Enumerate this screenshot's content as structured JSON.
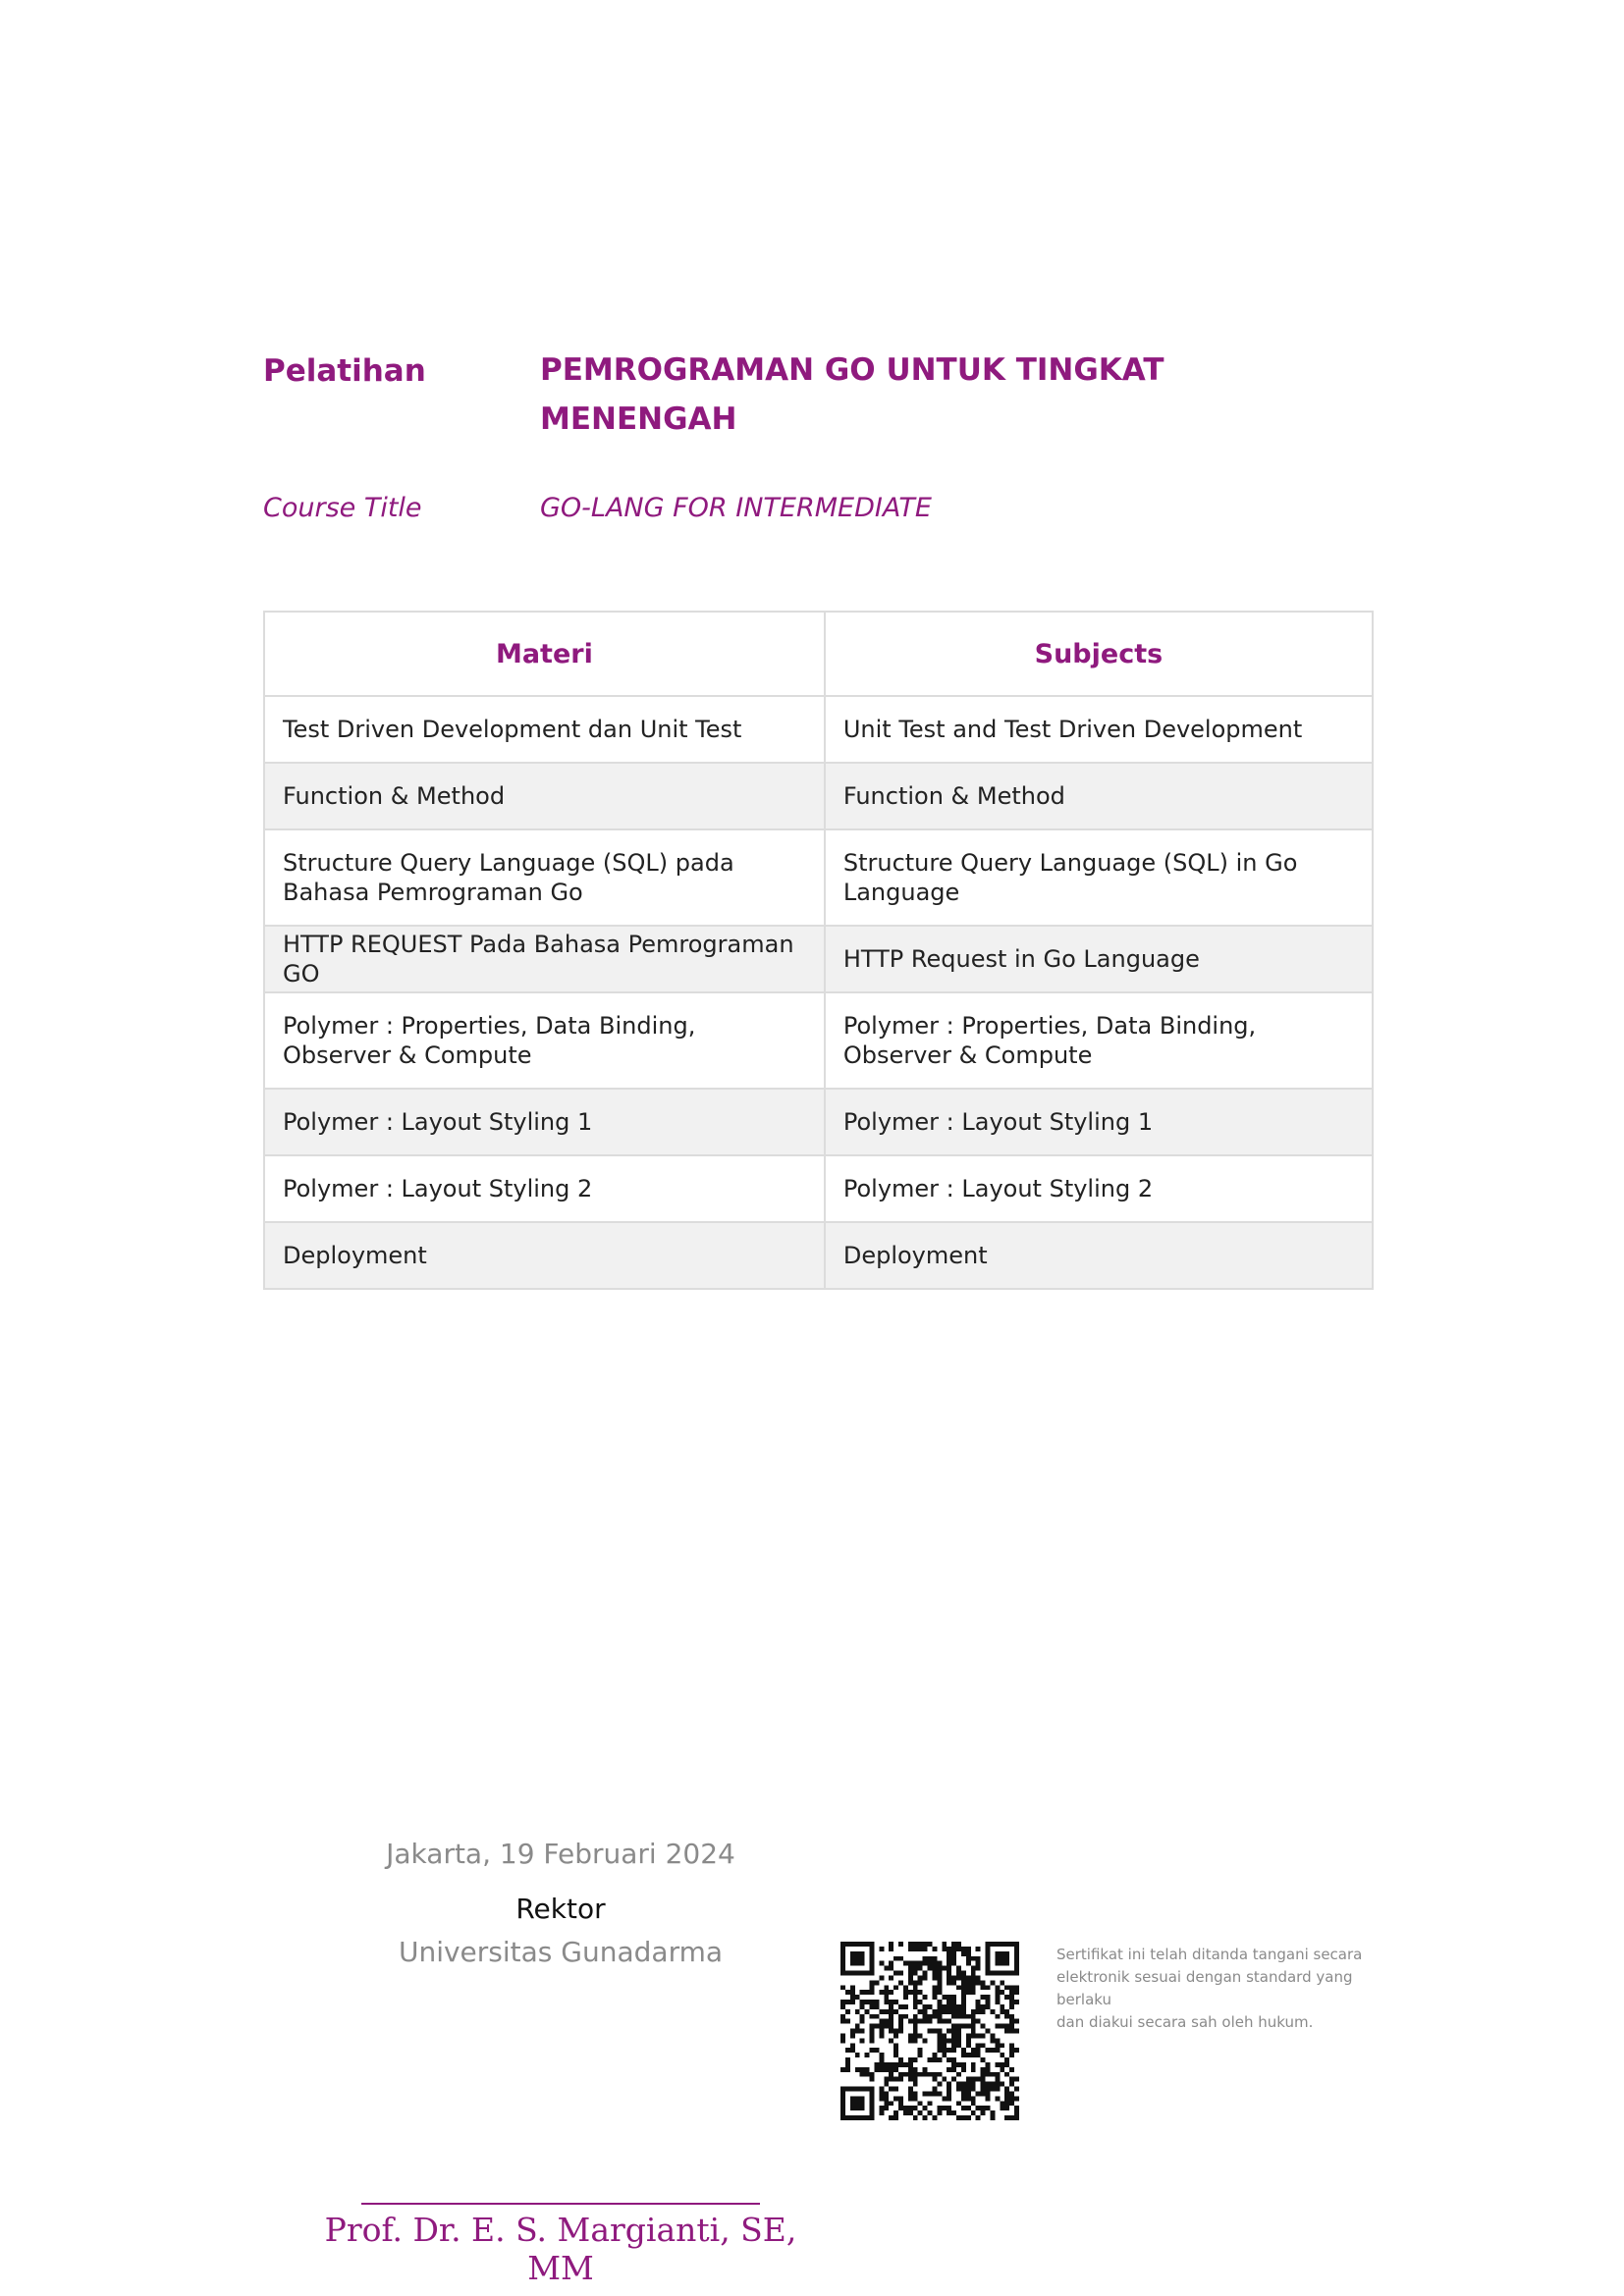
{
  "header": {
    "training_label": "Pelatihan",
    "training_title_line1": "PEMROGRAMAN GO UNTUK TINGKAT",
    "training_title_line2": "MENENGAH",
    "course_label": "Course Title",
    "course_title": "GO-LANG FOR INTERMEDIATE"
  },
  "table": {
    "headers": [
      "Materi",
      "Subjects"
    ],
    "rows": [
      [
        "Test Driven Development dan Unit Test",
        "Unit Test and Test Driven Development"
      ],
      [
        "Function & Method",
        "Function & Method"
      ],
      [
        "Structure Query Language (SQL) pada Bahasa Pemrograman Go",
        "Structure Query Language (SQL) in Go Language"
      ],
      [
        "HTTP REQUEST Pada Bahasa Pemrograman GO",
        "HTTP Request in Go Language"
      ],
      [
        "Polymer : Properties, Data Binding, Observer & Compute",
        "Polymer : Properties, Data Binding, Observer & Compute"
      ],
      [
        "Polymer : Layout Styling 1",
        "Polymer : Layout Styling 1"
      ],
      [
        "Polymer : Layout Styling 2",
        "Polymer : Layout Styling 2"
      ],
      [
        "Deployment",
        "Deployment"
      ]
    ]
  },
  "signature": {
    "place_date": "Jakarta, 19 Februari 2024",
    "role": "Rektor",
    "institution": "Universitas Gunadarma",
    "signer_name": "Prof. Dr. E. S. Margianti, SE, MM"
  },
  "qr": {
    "icon": "qr-code-icon",
    "note_line1": "Sertifikat ini telah ditanda tangani secara",
    "note_line2": "elektronik sesuai dengan standard yang",
    "note_line3": "berlaku",
    "note_line4": "dan diakui secara sah oleh hukum."
  },
  "colors": {
    "accent": "#8f1a7e",
    "muted_text": "#8a8a8a",
    "row_alt_bg": "#f1f1f1",
    "table_border": "#dcdcdc"
  }
}
